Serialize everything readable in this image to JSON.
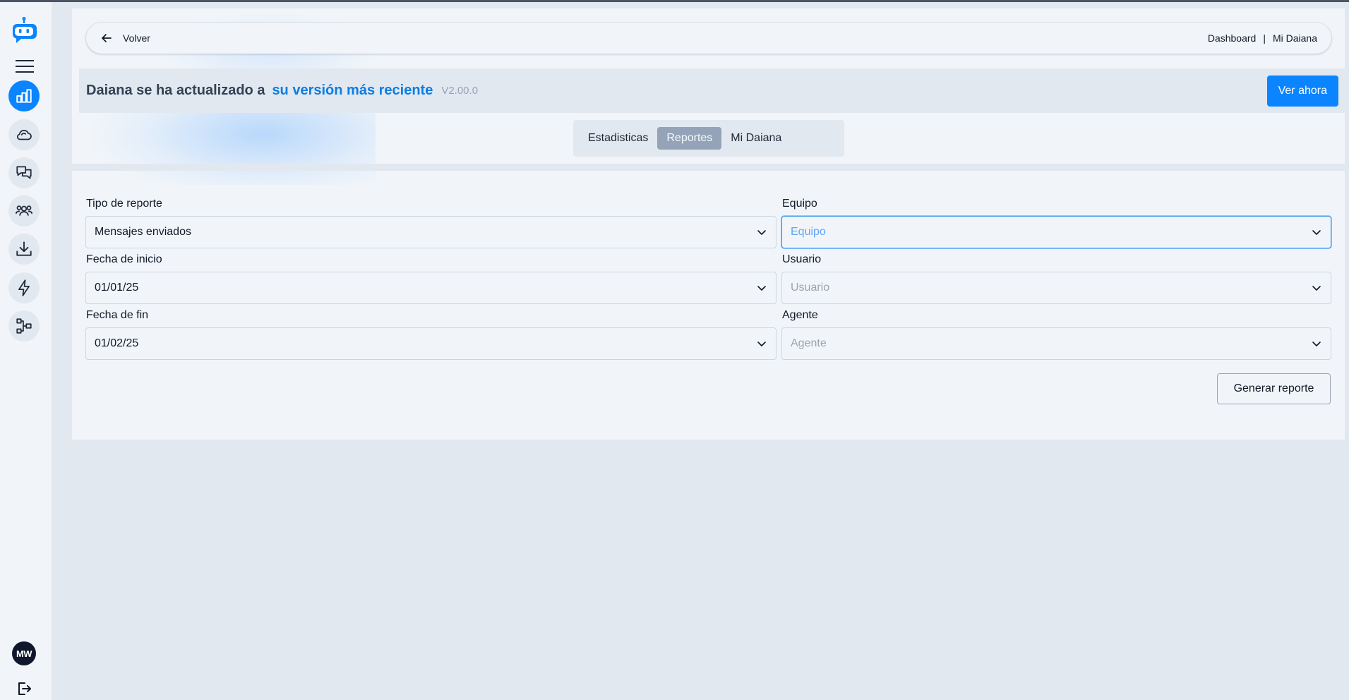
{
  "header": {
    "back_label": "Volver",
    "breadcrumbs": [
      "Dashboard",
      "|",
      "Mi Daiana"
    ]
  },
  "banner": {
    "text": "Daiana se ha actualizado a",
    "link": "su versión más reciente",
    "version": "V2.00.0",
    "button": "Ver ahora"
  },
  "tabs": [
    {
      "label": "Estadisticas",
      "active": false
    },
    {
      "label": "Reportes",
      "active": true
    },
    {
      "label": "Mi Daiana",
      "active": false
    }
  ],
  "form": {
    "report_type": {
      "label": "Tipo de reporte",
      "value": "Mensajes enviados"
    },
    "start_date": {
      "label": "Fecha de inicio",
      "value": "01/01/25"
    },
    "end_date": {
      "label": "Fecha de fin",
      "value": "01/02/25"
    },
    "team": {
      "label": "Equipo",
      "placeholder": "Equipo"
    },
    "user": {
      "label": "Usuario",
      "placeholder": "Usuario"
    },
    "agent": {
      "label": "Agente",
      "placeholder": "Agente"
    },
    "submit": "Generar reporte"
  },
  "user": {
    "initials": "MW"
  },
  "icons": {
    "sidebar": [
      "robot-logo-icon",
      "menu-icon",
      "bar-chart-icon",
      "cloud-icon",
      "chat-icon",
      "users-icon",
      "download-icon",
      "lightning-icon",
      "flow-icon",
      "logout-icon"
    ]
  },
  "colors": {
    "accent": "#0b84ff",
    "active_tab": "#94a3b8",
    "background": "#e2e8f0",
    "panel": "#f1f5f9"
  }
}
